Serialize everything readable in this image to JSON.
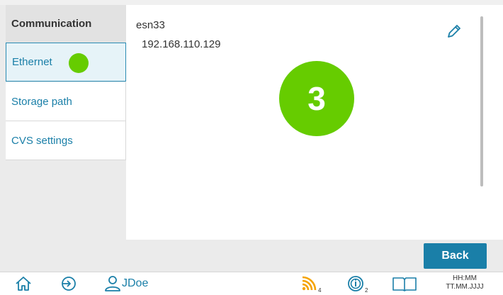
{
  "sidebar": {
    "header": "Communication",
    "items": [
      {
        "label": "Ethernet",
        "active": true
      },
      {
        "label": "Storage path",
        "active": false
      },
      {
        "label": "CVS settings",
        "active": false
      }
    ]
  },
  "main": {
    "interface_name": "esn33",
    "ip_address": "192.168.110.129",
    "badge_number": "3",
    "edit_icon": "pencil-icon"
  },
  "actions": {
    "back_label": "Back"
  },
  "taskbar": {
    "icons": [
      "home-icon",
      "logout-icon",
      "user-icon",
      "signal-icon",
      "info-icon",
      "book-icon"
    ],
    "user": "JDoe",
    "signal_count": "4",
    "info_count": "2",
    "time": "HH:MM",
    "date": "TT.MM.JJJJ"
  },
  "colors": {
    "accent": "#1a7fa8",
    "status_green": "#66cc00",
    "signal_orange": "#f5a300"
  }
}
